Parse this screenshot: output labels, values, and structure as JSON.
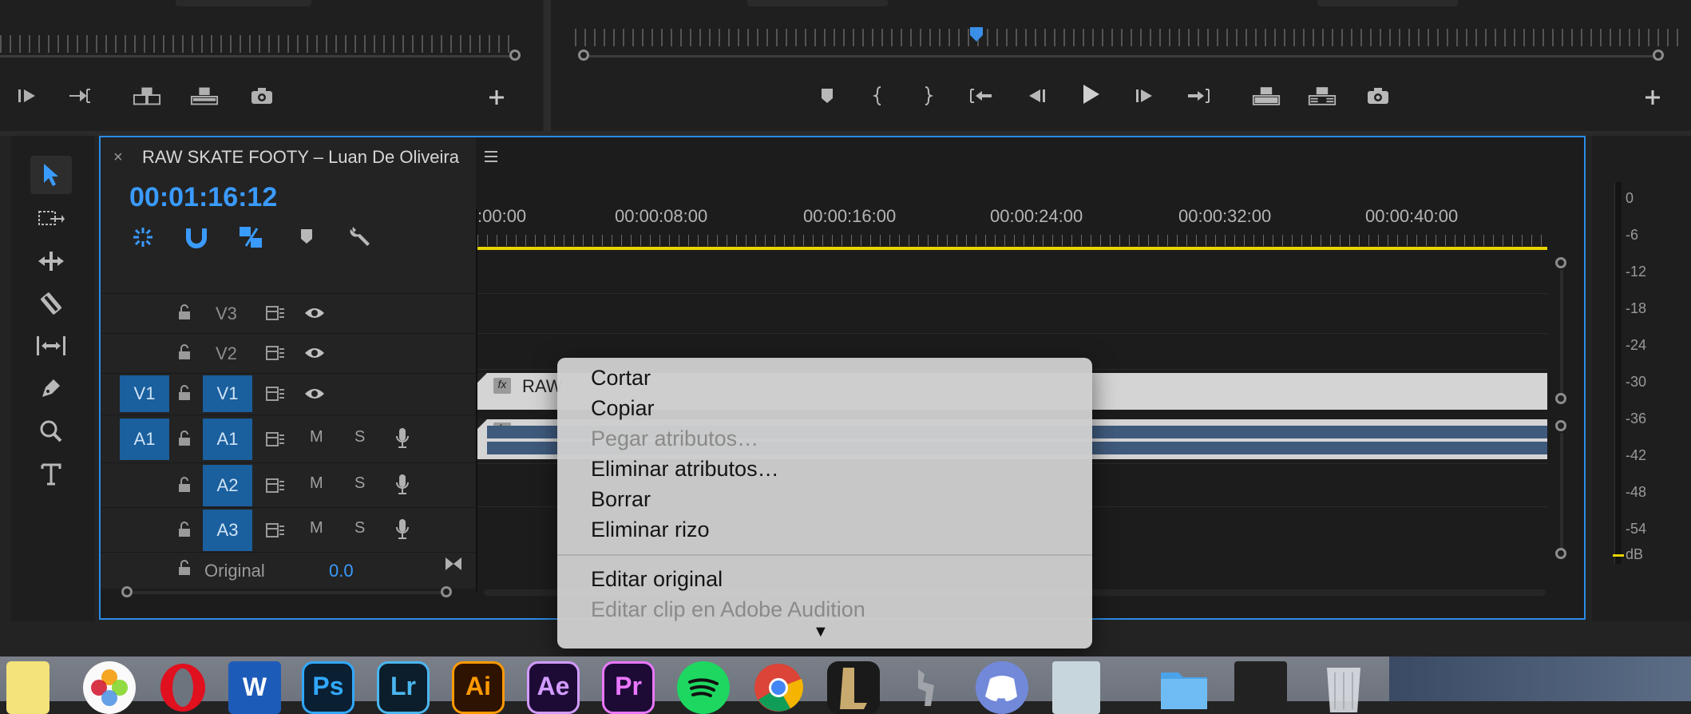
{
  "sequence": {
    "title": "RAW SKATE FOOTY – Luan De Oliveira",
    "timecode": "00:01:16:12",
    "ruler_labels": [
      ":00:00",
      "00:00:08:00",
      "00:00:16:00",
      "00:00:24:00",
      "00:00:32:00",
      "00:00:40:00"
    ]
  },
  "tracks": {
    "v3": "V3",
    "v2": "V2",
    "v1": "V1",
    "a1": "A1",
    "a2": "A2",
    "a3": "A3",
    "source_v1": "V1",
    "source_a1": "A1",
    "mute": "M",
    "solo": "S",
    "original_label": "Original",
    "original_value": "0.0"
  },
  "clip": {
    "name": "RAW",
    "fx_badge": "fx"
  },
  "meter": {
    "scale": [
      "0",
      "-6",
      "-12",
      "-18",
      "-24",
      "-30",
      "-36",
      "-42",
      "-48",
      "-54",
      "dB"
    ]
  },
  "context_menu": {
    "items": [
      {
        "label": "Cortar",
        "enabled": true
      },
      {
        "label": "Copiar",
        "enabled": true
      },
      {
        "label": "Pegar atributos…",
        "enabled": false
      },
      {
        "label": "Eliminar atributos…",
        "enabled": true
      },
      {
        "label": "Borrar",
        "enabled": true
      },
      {
        "label": "Eliminar rizo",
        "enabled": true
      },
      {
        "label": "Editar original",
        "enabled": true
      },
      {
        "label": "Editar clip en Adobe Audition",
        "enabled": false
      }
    ],
    "more_indicator": "▼"
  },
  "dock": {
    "photoshop": "Ps",
    "lightroom": "Lr",
    "illustrator": "Ai",
    "after_effects": "Ae",
    "premiere": "Pr",
    "word": "W"
  },
  "colors": {
    "accent_blue": "#2b8be6",
    "timecode_blue": "#3a9bff",
    "track_target": "#1a5f9e",
    "playhead_yellow": "#e8d400"
  }
}
